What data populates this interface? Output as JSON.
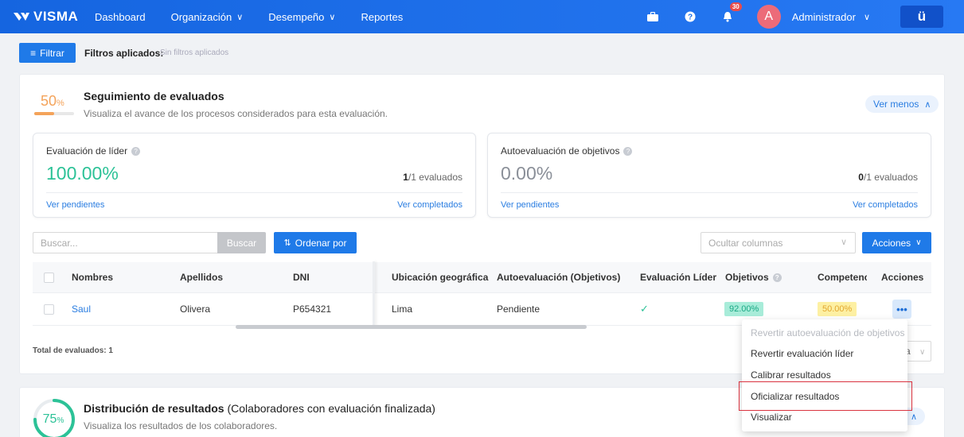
{
  "navbar": {
    "logo_text": "VISMA",
    "items": [
      {
        "label": "Dashboard",
        "has_dropdown": false
      },
      {
        "label": "Organización",
        "has_dropdown": true
      },
      {
        "label": "Desempeño",
        "has_dropdown": true
      },
      {
        "label": "Reportes",
        "has_dropdown": false
      }
    ],
    "notification_count": "30",
    "avatar_initial": "A",
    "user_name": "Administrador",
    "app_button": "ü",
    "icons": [
      "briefcase-icon",
      "help-icon",
      "bell-icon",
      "chevron-down-icon"
    ]
  },
  "filter": {
    "button_label": "Filtrar",
    "applied_label": "Filtros aplicados:",
    "applied_value": "Sin filtros aplicados"
  },
  "seguimiento": {
    "percent": "50",
    "percent_unit": "%",
    "progress": 0.5,
    "title": "Seguimiento de evaluados",
    "subtitle": "Visualiza el avance de los procesos considerados para esta evaluación.",
    "toggle_label": "Ver menos",
    "cards": [
      {
        "title": "Evaluación de líder",
        "value": "100.00%",
        "count": "1",
        "count_suffix": "/1 evaluados",
        "link_pending": "Ver pendientes",
        "link_done": "Ver completados",
        "value_color": "#2cc297"
      },
      {
        "title": "Autoevaluación de objetivos",
        "value": "0.00%",
        "count": "0",
        "count_suffix": "/1 evaluados",
        "link_pending": "Ver pendientes",
        "link_done": "Ver completados",
        "value_color": "#8a8f98"
      }
    ]
  },
  "toolbar": {
    "search_placeholder": "Buscar...",
    "search_button": "Buscar",
    "sort_button": "Ordenar por",
    "columns_placeholder": "Ocultar columnas",
    "actions_button": "Acciones"
  },
  "table": {
    "headers": [
      "Nombres",
      "Apellidos",
      "DNI",
      "Ubicación geográfica",
      "Autoevaluación (Objetivos)",
      "Evaluación Líder",
      "Objetivos",
      "Competenci",
      "Acciones"
    ],
    "rows": [
      {
        "nombres": "Saul",
        "apellidos": "Olivera",
        "dni": "P654321",
        "ubicacion": "Lima",
        "autoevaluacion": "Pendiente",
        "evaluacion_lider": "✓",
        "objetivos": "92.00%",
        "competencias": "50.00%",
        "acciones": "•••"
      }
    ],
    "total_label": "Total de evaluados: 1",
    "pagination_suffix": "a"
  },
  "actions_menu": {
    "items": [
      {
        "label": "Revertir autoevaluación de objetivos",
        "disabled": true
      },
      {
        "label": "Revertir evaluación líder",
        "disabled": false
      },
      {
        "label": "Calibrar resultados",
        "disabled": false
      },
      {
        "label": "Oficializar resultados",
        "disabled": false,
        "highlighted": true
      },
      {
        "label": "Visualizar",
        "disabled": false
      }
    ]
  },
  "distribucion": {
    "percent": "75",
    "percent_unit": "%",
    "progress": 0.75,
    "title_bold": "Distribución de resultados",
    "title_normal": " (Colaboradores con evaluación finalizada)",
    "subtitle": "Visualiza los resultados de los colaboradores.",
    "toggle_label": "s"
  },
  "colors": {
    "primary": "#1f7ae8",
    "nav": "#1a6fea",
    "accent_orange": "#f4a35a",
    "success": "#2cc297",
    "highlight": "#d9333f"
  }
}
